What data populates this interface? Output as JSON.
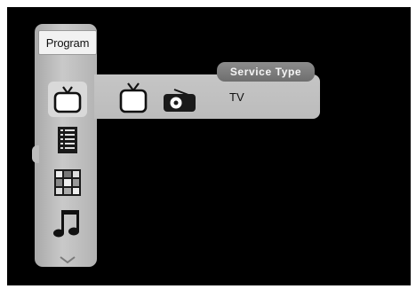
{
  "menu": {
    "title": "Program",
    "items": [
      {
        "icon": "tv-icon",
        "selected": true
      },
      {
        "icon": "list-icon",
        "selected": false
      },
      {
        "icon": "grid-icon",
        "selected": false
      },
      {
        "icon": "music-note-icon",
        "selected": false
      }
    ],
    "more_icon": "chevron-down-icon"
  },
  "submenu": {
    "header": "Service Type",
    "value": "TV",
    "options": [
      {
        "icon": "tv-icon"
      },
      {
        "icon": "radio-icon"
      }
    ]
  },
  "colors": {
    "background": "#000000",
    "panel": "#c0c0c0",
    "header_pill": "#7a7a7a"
  }
}
